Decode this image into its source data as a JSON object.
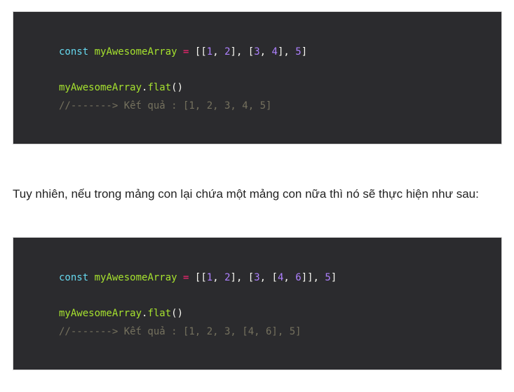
{
  "block1": {
    "line1": {
      "kw": "const",
      "var": "myAwesomeArray",
      "op": "=",
      "tokens": [
        {
          "t": "punc",
          "v": "[["
        },
        {
          "t": "num",
          "v": "1"
        },
        {
          "t": "punc",
          "v": ", "
        },
        {
          "t": "num",
          "v": "2"
        },
        {
          "t": "punc",
          "v": "], ["
        },
        {
          "t": "num",
          "v": "3"
        },
        {
          "t": "punc",
          "v": ", "
        },
        {
          "t": "num",
          "v": "4"
        },
        {
          "t": "punc",
          "v": "], "
        },
        {
          "t": "num",
          "v": "5"
        },
        {
          "t": "punc",
          "v": "]"
        }
      ]
    },
    "line2": {
      "obj": "myAwesomeArray",
      "dot": ".",
      "fn": "flat",
      "parens": "()"
    },
    "line3": {
      "comment": "//-------> Kết quả : [1, 2, 3, 4, 5]"
    }
  },
  "paragraph": "Tuy nhiên, nếu trong mảng con lại chứa một mảng con nữa thì nó sẽ thực hiện như sau:",
  "block2": {
    "line1": {
      "kw": "const",
      "var": "myAwesomeArray",
      "op": "=",
      "tokens": [
        {
          "t": "punc",
          "v": "[["
        },
        {
          "t": "num",
          "v": "1"
        },
        {
          "t": "punc",
          "v": ", "
        },
        {
          "t": "num",
          "v": "2"
        },
        {
          "t": "punc",
          "v": "], ["
        },
        {
          "t": "num",
          "v": "3"
        },
        {
          "t": "punc",
          "v": ", ["
        },
        {
          "t": "num",
          "v": "4"
        },
        {
          "t": "punc",
          "v": ", "
        },
        {
          "t": "num",
          "v": "6"
        },
        {
          "t": "punc",
          "v": "]], "
        },
        {
          "t": "num",
          "v": "5"
        },
        {
          "t": "punc",
          "v": "]"
        }
      ]
    },
    "line2": {
      "obj": "myAwesomeArray",
      "dot": ".",
      "fn": "flat",
      "parens": "()"
    },
    "line3": {
      "comment": "//-------> Kết quả : [1, 2, 3, [4, 6], 5]"
    }
  },
  "colors": {
    "code_bg": "#2b2b2e",
    "keyword": "#66d9ef",
    "variable": "#a6e22e",
    "operator": "#f92672",
    "number": "#ae81ff",
    "comment": "#75715e",
    "text": "#222222"
  }
}
